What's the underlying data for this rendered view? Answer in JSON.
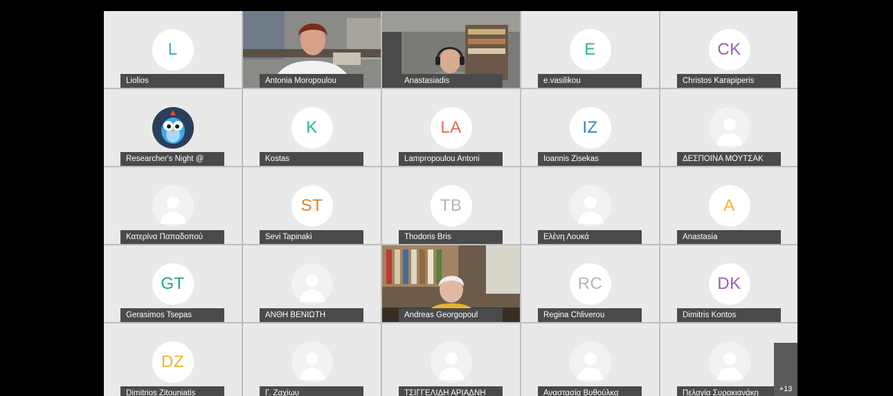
{
  "participants": [
    {
      "name": "Liolios",
      "initials": "L",
      "color": "#36a8c4",
      "kind": "initials"
    },
    {
      "name": "Antonia Moropoulou",
      "kind": "video-woman"
    },
    {
      "name": "Anastasiadis",
      "kind": "video-man"
    },
    {
      "name": "e.vasilikou",
      "initials": "E",
      "color": "#2bb39a",
      "kind": "initials"
    },
    {
      "name": "Christos Karapiperis",
      "initials": "CK",
      "color": "#9b59b6",
      "kind": "initials"
    },
    {
      "name": "Researcher's Night @",
      "kind": "bird"
    },
    {
      "name": "Kostas",
      "initials": "K",
      "color": "#2bb39a",
      "kind": "initials"
    },
    {
      "name": "Lampropoulou Antoni",
      "initials": "LA",
      "color": "#e0675f",
      "kind": "initials"
    },
    {
      "name": "Ioannis Zisekas",
      "initials": "IZ",
      "color": "#2e86c1",
      "kind": "initials"
    },
    {
      "name": "ΔΕΣΠΟΙΝΑ ΜΟΥΤΣΑΚ",
      "kind": "placeholder"
    },
    {
      "name": "Κατερίνα Παπαδοπού",
      "kind": "placeholder"
    },
    {
      "name": "Sevi Tapinaki",
      "initials": "ST",
      "color": "#e67e22",
      "kind": "initials"
    },
    {
      "name": "Thodoris Bris",
      "initials": "TB",
      "color": "#b5b5b5",
      "kind": "initials"
    },
    {
      "name": "Ελένη Λουκά",
      "kind": "placeholder"
    },
    {
      "name": "Anastasia",
      "initials": "A",
      "color": "#f0b429",
      "kind": "initials"
    },
    {
      "name": "Gerasimos Tsepas",
      "initials": "GT",
      "color": "#17a589",
      "kind": "initials"
    },
    {
      "name": "ΑΝΘΗ ΒΕΝΙΩΤΗ",
      "kind": "placeholder"
    },
    {
      "name": "Andreas Georgopoul",
      "kind": "video-elder"
    },
    {
      "name": "Regina Chliverou",
      "initials": "RC",
      "color": "#b5b5b5",
      "kind": "initials"
    },
    {
      "name": "Dimitris Kontos",
      "initials": "DK",
      "color": "#9b59b6",
      "kind": "initials"
    },
    {
      "name": "Dimitrios Zitouniatis",
      "initials": "DZ",
      "color": "#f0b429",
      "kind": "initials"
    },
    {
      "name": "Γ. Ζαχίωυ",
      "kind": "placeholder"
    },
    {
      "name": "ΤΣΙΓΓΕΛΙΔΗ ΑΡΙΑΔΝΗ",
      "kind": "placeholder"
    },
    {
      "name": "Αναστασία Βυθούλκα",
      "kind": "placeholder"
    },
    {
      "name": "Πελαγία Συρακιανάκη",
      "kind": "placeholder"
    }
  ],
  "overflow": {
    "label": "+13"
  }
}
